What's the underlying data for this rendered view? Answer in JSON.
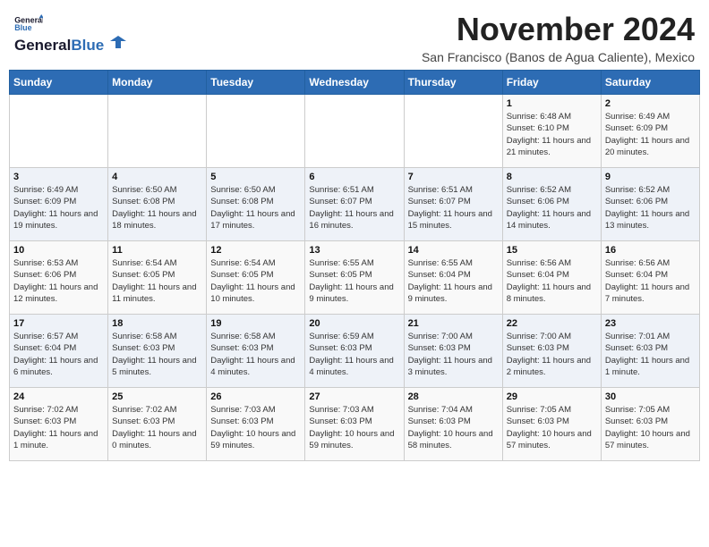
{
  "header": {
    "logo_line1": "General",
    "logo_line2": "Blue",
    "month": "November 2024",
    "location": "San Francisco (Banos de Agua Caliente), Mexico"
  },
  "weekdays": [
    "Sunday",
    "Monday",
    "Tuesday",
    "Wednesday",
    "Thursday",
    "Friday",
    "Saturday"
  ],
  "weeks": [
    [
      {
        "day": "",
        "info": ""
      },
      {
        "day": "",
        "info": ""
      },
      {
        "day": "",
        "info": ""
      },
      {
        "day": "",
        "info": ""
      },
      {
        "day": "",
        "info": ""
      },
      {
        "day": "1",
        "info": "Sunrise: 6:48 AM\nSunset: 6:10 PM\nDaylight: 11 hours\nand 21 minutes."
      },
      {
        "day": "2",
        "info": "Sunrise: 6:49 AM\nSunset: 6:09 PM\nDaylight: 11 hours\nand 20 minutes."
      }
    ],
    [
      {
        "day": "3",
        "info": "Sunrise: 6:49 AM\nSunset: 6:09 PM\nDaylight: 11 hours\nand 19 minutes."
      },
      {
        "day": "4",
        "info": "Sunrise: 6:50 AM\nSunset: 6:08 PM\nDaylight: 11 hours\nand 18 minutes."
      },
      {
        "day": "5",
        "info": "Sunrise: 6:50 AM\nSunset: 6:08 PM\nDaylight: 11 hours\nand 17 minutes."
      },
      {
        "day": "6",
        "info": "Sunrise: 6:51 AM\nSunset: 6:07 PM\nDaylight: 11 hours\nand 16 minutes."
      },
      {
        "day": "7",
        "info": "Sunrise: 6:51 AM\nSunset: 6:07 PM\nDaylight: 11 hours\nand 15 minutes."
      },
      {
        "day": "8",
        "info": "Sunrise: 6:52 AM\nSunset: 6:06 PM\nDaylight: 11 hours\nand 14 minutes."
      },
      {
        "day": "9",
        "info": "Sunrise: 6:52 AM\nSunset: 6:06 PM\nDaylight: 11 hours\nand 13 minutes."
      }
    ],
    [
      {
        "day": "10",
        "info": "Sunrise: 6:53 AM\nSunset: 6:06 PM\nDaylight: 11 hours\nand 12 minutes."
      },
      {
        "day": "11",
        "info": "Sunrise: 6:54 AM\nSunset: 6:05 PM\nDaylight: 11 hours\nand 11 minutes."
      },
      {
        "day": "12",
        "info": "Sunrise: 6:54 AM\nSunset: 6:05 PM\nDaylight: 11 hours\nand 10 minutes."
      },
      {
        "day": "13",
        "info": "Sunrise: 6:55 AM\nSunset: 6:05 PM\nDaylight: 11 hours\nand 9 minutes."
      },
      {
        "day": "14",
        "info": "Sunrise: 6:55 AM\nSunset: 6:04 PM\nDaylight: 11 hours\nand 9 minutes."
      },
      {
        "day": "15",
        "info": "Sunrise: 6:56 AM\nSunset: 6:04 PM\nDaylight: 11 hours\nand 8 minutes."
      },
      {
        "day": "16",
        "info": "Sunrise: 6:56 AM\nSunset: 6:04 PM\nDaylight: 11 hours\nand 7 minutes."
      }
    ],
    [
      {
        "day": "17",
        "info": "Sunrise: 6:57 AM\nSunset: 6:04 PM\nDaylight: 11 hours\nand 6 minutes."
      },
      {
        "day": "18",
        "info": "Sunrise: 6:58 AM\nSunset: 6:03 PM\nDaylight: 11 hours\nand 5 minutes."
      },
      {
        "day": "19",
        "info": "Sunrise: 6:58 AM\nSunset: 6:03 PM\nDaylight: 11 hours\nand 4 minutes."
      },
      {
        "day": "20",
        "info": "Sunrise: 6:59 AM\nSunset: 6:03 PM\nDaylight: 11 hours\nand 4 minutes."
      },
      {
        "day": "21",
        "info": "Sunrise: 7:00 AM\nSunset: 6:03 PM\nDaylight: 11 hours\nand 3 minutes."
      },
      {
        "day": "22",
        "info": "Sunrise: 7:00 AM\nSunset: 6:03 PM\nDaylight: 11 hours\nand 2 minutes."
      },
      {
        "day": "23",
        "info": "Sunrise: 7:01 AM\nSunset: 6:03 PM\nDaylight: 11 hours\nand 1 minute."
      }
    ],
    [
      {
        "day": "24",
        "info": "Sunrise: 7:02 AM\nSunset: 6:03 PM\nDaylight: 11 hours\nand 1 minute."
      },
      {
        "day": "25",
        "info": "Sunrise: 7:02 AM\nSunset: 6:03 PM\nDaylight: 11 hours\nand 0 minutes."
      },
      {
        "day": "26",
        "info": "Sunrise: 7:03 AM\nSunset: 6:03 PM\nDaylight: 10 hours\nand 59 minutes."
      },
      {
        "day": "27",
        "info": "Sunrise: 7:03 AM\nSunset: 6:03 PM\nDaylight: 10 hours\nand 59 minutes."
      },
      {
        "day": "28",
        "info": "Sunrise: 7:04 AM\nSunset: 6:03 PM\nDaylight: 10 hours\nand 58 minutes."
      },
      {
        "day": "29",
        "info": "Sunrise: 7:05 AM\nSunset: 6:03 PM\nDaylight: 10 hours\nand 57 minutes."
      },
      {
        "day": "30",
        "info": "Sunrise: 7:05 AM\nSunset: 6:03 PM\nDaylight: 10 hours\nand 57 minutes."
      }
    ]
  ]
}
